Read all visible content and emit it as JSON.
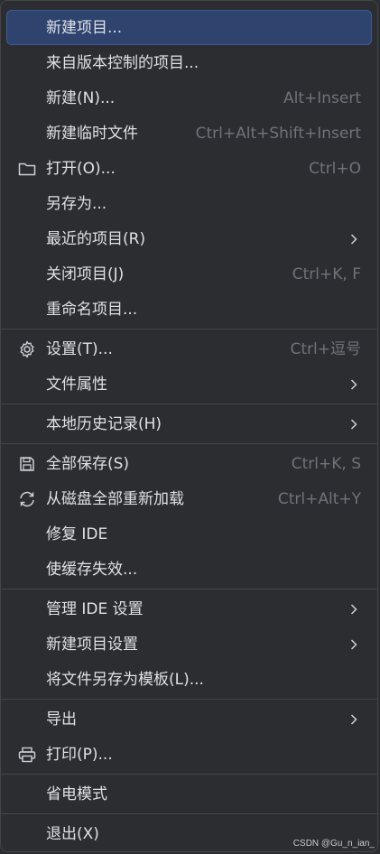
{
  "menu": {
    "items": [
      {
        "label": "新建项目...",
        "shortcut": ""
      },
      {
        "label": "来自版本控制的项目...",
        "shortcut": ""
      },
      {
        "label": "新建(N)...",
        "shortcut": "Alt+Insert"
      },
      {
        "label": "新建临时文件",
        "shortcut": "Ctrl+Alt+Shift+Insert"
      },
      {
        "label": "打开(O)...",
        "shortcut": "Ctrl+O",
        "icon": "folder-icon"
      },
      {
        "label": "另存为...",
        "shortcut": ""
      },
      {
        "label": "最近的项目(R)",
        "shortcut": ""
      },
      {
        "label": "关闭项目(J)",
        "shortcut": "Ctrl+K, F"
      },
      {
        "label": "重命名项目...",
        "shortcut": ""
      },
      {
        "label": "设置(T)...",
        "shortcut": "Ctrl+逗号",
        "icon": "gear-icon"
      },
      {
        "label": "文件属性",
        "shortcut": ""
      },
      {
        "label": "本地历史记录(H)",
        "shortcut": ""
      },
      {
        "label": "全部保存(S)",
        "shortcut": "Ctrl+K, S",
        "icon": "save-icon"
      },
      {
        "label": "从磁盘全部重新加载",
        "shortcut": "Ctrl+Alt+Y",
        "icon": "reload-icon"
      },
      {
        "label": "修复 IDE",
        "shortcut": ""
      },
      {
        "label": "使缓存失效...",
        "shortcut": ""
      },
      {
        "label": "管理 IDE 设置",
        "shortcut": ""
      },
      {
        "label": "新建项目设置",
        "shortcut": ""
      },
      {
        "label": "将文件另存为模板(L)...",
        "shortcut": ""
      },
      {
        "label": "导出",
        "shortcut": ""
      },
      {
        "label": "打印(P)...",
        "shortcut": "",
        "icon": "printer-icon"
      },
      {
        "label": "省电模式",
        "shortcut": ""
      },
      {
        "label": "退出(X)",
        "shortcut": ""
      }
    ]
  },
  "watermark": "CSDN @Gu_n_ian_",
  "colors": {
    "background": "#2b2d30",
    "selected": "#2e436e",
    "text": "#dfe1e5",
    "shortcut": "#6f737a",
    "separator": "#43454a"
  }
}
